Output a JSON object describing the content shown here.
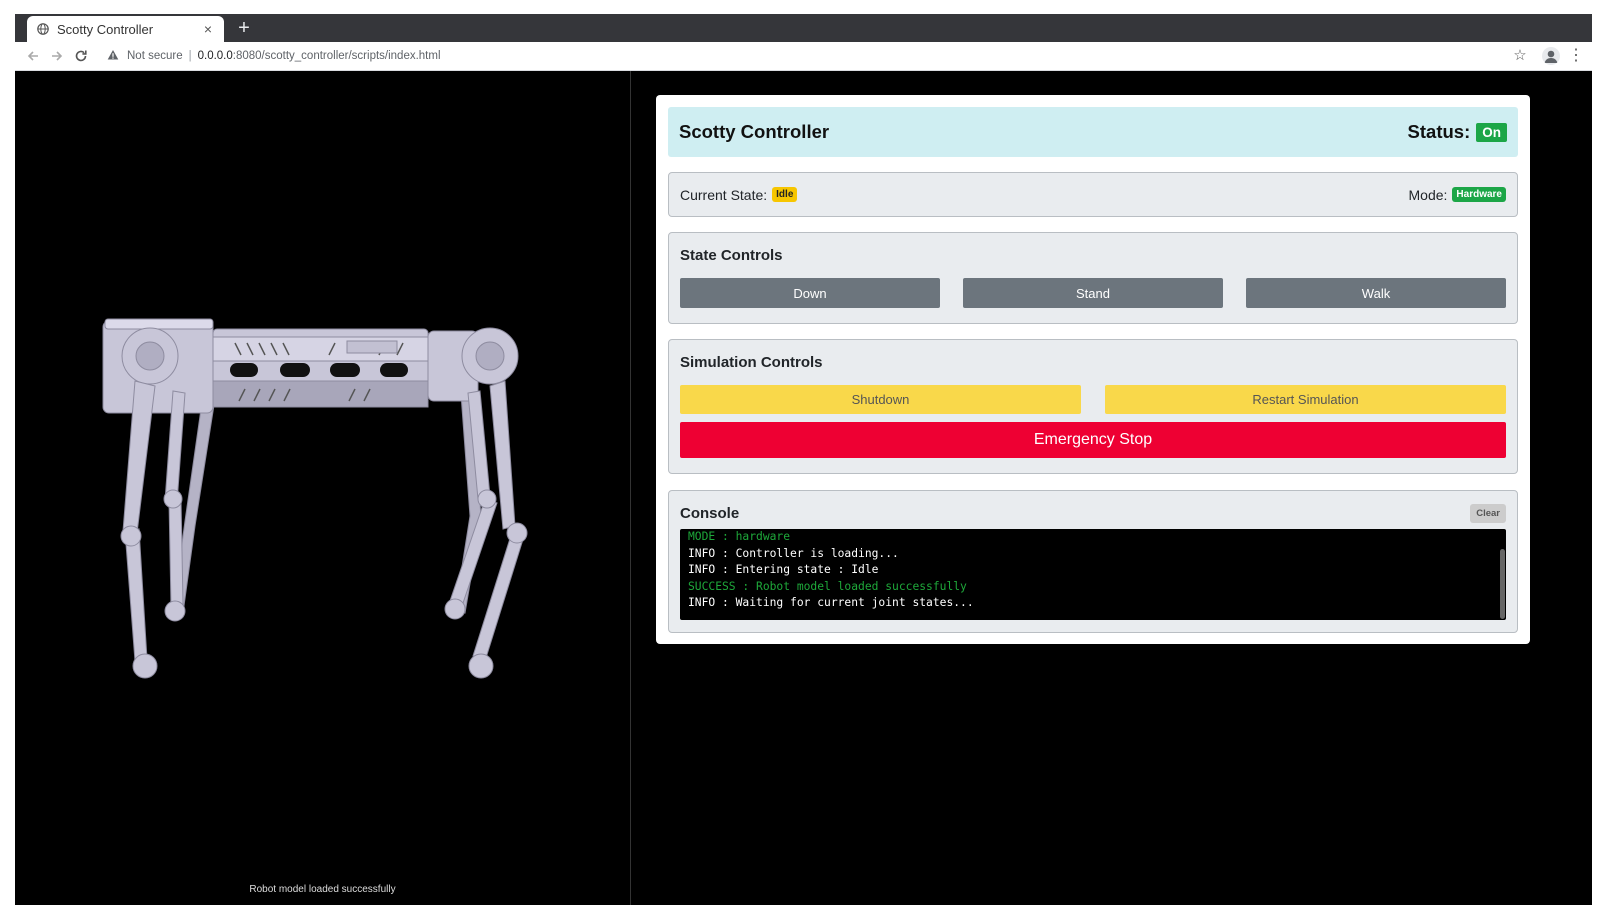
{
  "browser": {
    "tab_title": "Scotty Controller",
    "tab_close": "×",
    "new_tab": "+",
    "security_label": "Not secure",
    "url_host": "0.0.0.0",
    "url_path": ":8080/scotty_controller/scripts/index.html"
  },
  "scene": {
    "status_text": "Robot model loaded successfully",
    "robot_color": "#c8c6d8"
  },
  "header": {
    "title": "Scotty Controller",
    "status_label": "Status:",
    "status_value": "On"
  },
  "state_bar": {
    "current_state_label": "Current State:",
    "current_state_value": "Idle",
    "mode_label": "Mode:",
    "mode_value": "Hardware"
  },
  "state_controls": {
    "title": "State Controls",
    "buttons": [
      "Down",
      "Stand",
      "Walk"
    ]
  },
  "simulation_controls": {
    "title": "Simulation Controls",
    "shutdown_label": "Shutdown",
    "restart_label": "Restart Simulation",
    "emergency_label": "Emergency Stop"
  },
  "console": {
    "title": "Console",
    "clear_label": "Clear",
    "lines": [
      {
        "text": "MODE : hardware",
        "color": "#1ea83a"
      },
      {
        "text": "INFO : Controller is loading...",
        "color": "#ffffff"
      },
      {
        "text": "INFO : Entering state : Idle",
        "color": "#ffffff"
      },
      {
        "text": "SUCCESS : Robot model loaded successfully",
        "color": "#1ea83a"
      },
      {
        "text": "INFO : Waiting for current joint states...",
        "color": "#ffffff"
      }
    ]
  },
  "colors": {
    "header_bg": "#cfeef2",
    "success": "#1ca647",
    "warning": "#f7c600",
    "danger": "#ee0033",
    "secondary": "#6c757d"
  },
  "icons": {
    "tab_favicon": "globe-icon",
    "back": "arrow-left-icon",
    "forward": "arrow-right-icon",
    "reload": "reload-icon",
    "security": "warning-triangle-icon",
    "bookmark": "star-icon",
    "profile": "profile-icon",
    "menu": "kebab-menu-icon"
  }
}
